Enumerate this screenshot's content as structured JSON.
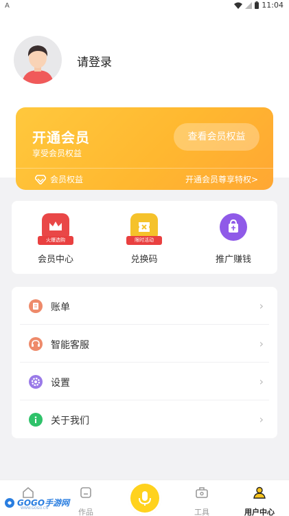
{
  "status_bar": {
    "left_icon": "A",
    "time": "11:04"
  },
  "profile": {
    "login_label": "请登录"
  },
  "vip_card": {
    "title": "开通会员",
    "subtitle": "享受会员权益",
    "button_label": "查看会员权益",
    "rights_label": "会员权益",
    "promo_label": "开通会员尊享特权>"
  },
  "quick_actions": [
    {
      "label": "会员中心",
      "tag": "火爆选购",
      "icon": "crown-icon",
      "color": "#e94747"
    },
    {
      "label": "兑换码",
      "tag": "限时活动",
      "icon": "ticket-icon",
      "color": "#f5c22b"
    },
    {
      "label": "推广赚钱",
      "tag": "",
      "icon": "gift-bag-icon",
      "color": "#8f5ae8"
    }
  ],
  "menu": [
    {
      "label": "账单",
      "icon": "bill-icon",
      "color": "#ee8a6a"
    },
    {
      "label": "智能客服",
      "icon": "headset-icon",
      "color": "#ee8a6a"
    },
    {
      "label": "设置",
      "icon": "settings-icon",
      "color": "#9a7ae8"
    },
    {
      "label": "关于我们",
      "icon": "info-icon",
      "color": "#2fc26a"
    }
  ],
  "tabs": [
    {
      "label": "",
      "icon": "home-icon"
    },
    {
      "label": "作品",
      "icon": "works-icon"
    },
    {
      "label": "",
      "icon": "mic-icon"
    },
    {
      "label": "工具",
      "icon": "toolbox-icon"
    },
    {
      "label": "用户中心",
      "icon": "user-icon",
      "active": true
    }
  ],
  "watermark": {
    "brand": "GOGO手游网",
    "url": "WWW.GOGO.CN"
  },
  "colors": {
    "vip_gradient_start": "#ffc83d",
    "vip_gradient_end": "#ffa733",
    "accent_yellow": "#ffd21e",
    "page_bg": "#f2f2f4"
  }
}
